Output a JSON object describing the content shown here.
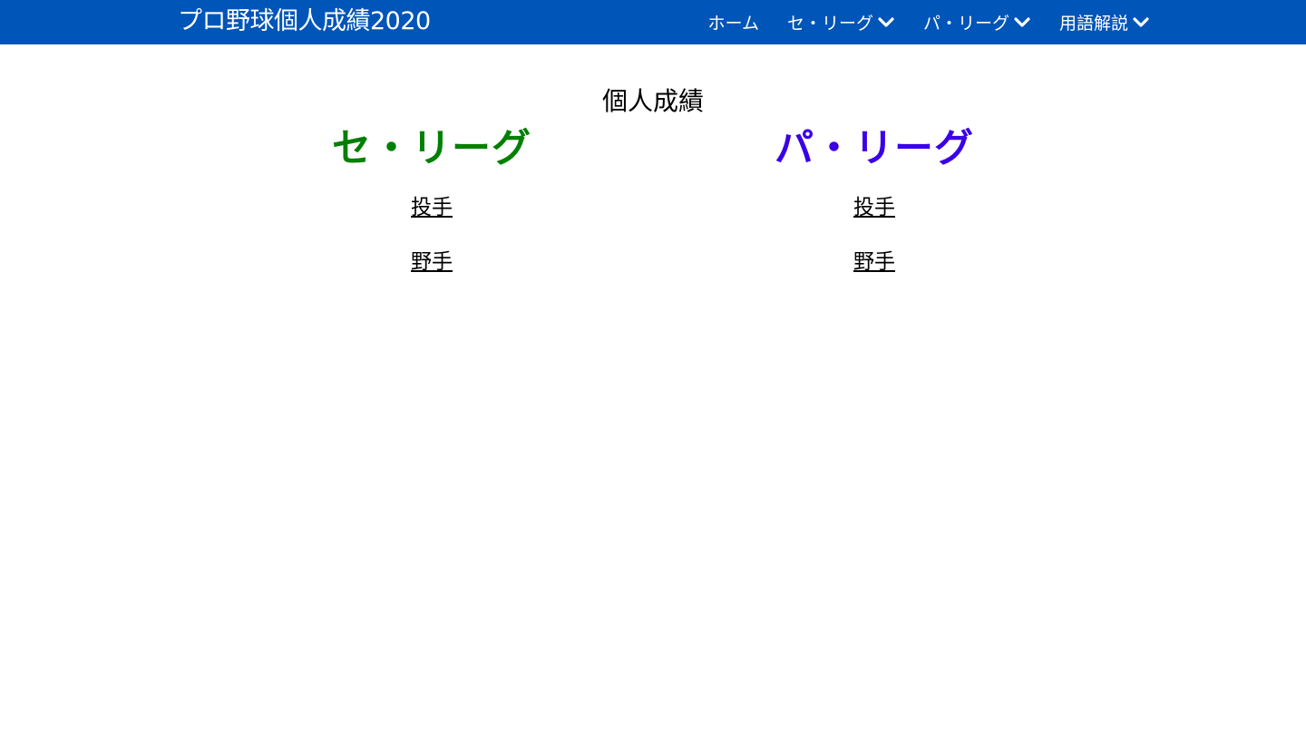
{
  "navbar": {
    "brand": "プロ野球個人成績2020",
    "items": [
      {
        "label": "ホーム",
        "dropdown": false
      },
      {
        "label": "セ・リーグ",
        "dropdown": true
      },
      {
        "label": "パ・リーグ",
        "dropdown": true
      },
      {
        "label": "用語解説",
        "dropdown": true
      }
    ]
  },
  "main": {
    "title": "個人成績",
    "leagues": [
      {
        "name": "セ・リーグ",
        "color": "#008000",
        "links": [
          {
            "label": "投手"
          },
          {
            "label": "野手"
          }
        ]
      },
      {
        "name": "パ・リーグ",
        "color": "#3a00e6",
        "links": [
          {
            "label": "投手"
          },
          {
            "label": "野手"
          }
        ]
      }
    ]
  },
  "colors": {
    "navbar_bg": "#0055b8",
    "nav_text": "#ffffff"
  },
  "icons": {
    "dropdown": "chevron-down-icon"
  }
}
